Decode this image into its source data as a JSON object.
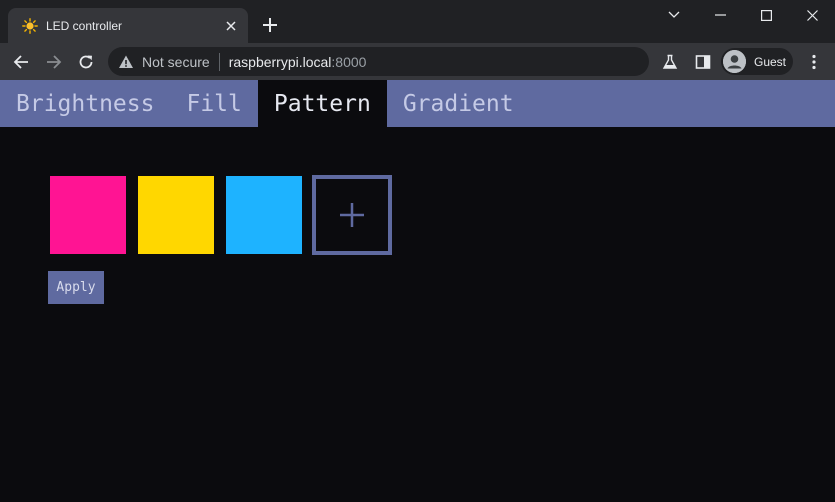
{
  "browser": {
    "tab_title": "LED controller",
    "new_tab_glyph": "+",
    "security_label": "Not secure",
    "url_host": "raspberrypi.local",
    "url_port": ":8000",
    "profile_label": "Guest"
  },
  "nav": {
    "tabs": [
      {
        "label": "Brightness",
        "active": false
      },
      {
        "label": "Fill",
        "active": false
      },
      {
        "label": "Pattern",
        "active": true
      },
      {
        "label": "Gradient",
        "active": false
      }
    ]
  },
  "pattern": {
    "colors": [
      "#ff1493",
      "#ffd700",
      "#1eb3ff"
    ],
    "add_glyph": "+",
    "apply_label": "Apply"
  },
  "theme": {
    "accent": "#5f6aa0",
    "background": "#0b0b0e"
  },
  "icons": {
    "favicon": "sun-icon",
    "back": "arrow-left-icon",
    "forward": "arrow-right-icon",
    "reload": "reload-icon",
    "warning": "warning-icon",
    "labs": "flask-icon",
    "side_panel": "side-panel-icon",
    "profile": "person-icon"
  }
}
